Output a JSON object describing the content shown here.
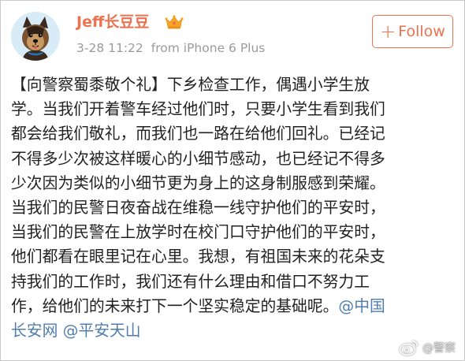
{
  "user": {
    "name": "Jeff长豆豆",
    "avatar_icon": "dog-cartoon-avatar",
    "badge_icon": "vip-crown-icon"
  },
  "post_meta": {
    "time": "3-28 11:22",
    "source": "from iPhone 6 Plus"
  },
  "follow_button": {
    "plus": "+",
    "label": "Follow"
  },
  "post": {
    "lines": [
      "【向警察蜀黍敬个礼】下乡检查工作，偶遇小学生放",
      "学。当我们开着警车经过他们时，只要小学生看到我们",
      "都会给我们敬礼，而我们也一路在给他们回礼。已经记",
      "不得多少次被这样暖心的小细节感动，也已经记不得多",
      "少次因为类似的小细节更为身上的这身制服感到荣耀。",
      "当我们的民警日夜奋战在维稳一线守护他们的平安时，",
      "当我们的民警在上放学时在校门口守护他们的平安时，",
      "他们都看在眼里记在心里。我想，有祖国未来的花朵支",
      "持我们的工作时，我们还有什么理由和借口不努力工"
    ],
    "line10_text": "作，给他们的未来打下一个坚实稳定的基础呢。",
    "mention1": "@中国",
    "line11_mention1_cont": "长安网",
    "mention2": "@平安天山"
  },
  "watermark": {
    "icon": "weibo-logo-icon",
    "text": "@警察"
  },
  "colors": {
    "accent": "#eb7350",
    "mention": "#507daf",
    "meta": "#9b9b9b",
    "text": "#222222"
  }
}
